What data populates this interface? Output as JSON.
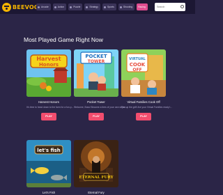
{
  "header": {
    "logo_text": "BEEVOO",
    "nav": [
      {
        "label": "Arcade",
        "icon": "gamepad-icon"
      },
      {
        "label": "Action",
        "icon": "bolt-icon"
      },
      {
        "label": "Puzzle",
        "icon": "puzzle-icon"
      },
      {
        "label": "Strategy",
        "icon": "chess-icon"
      },
      {
        "label": "Sports",
        "icon": "ball-icon"
      },
      {
        "label": "Shooting",
        "icon": "target-icon"
      },
      {
        "label": "Racing",
        "icon": "flag-icon"
      }
    ],
    "search_placeholder": "Search"
  },
  "main": {
    "title": "Most Played Game Right Now",
    "games": [
      {
        "name": "Harvest Honors",
        "desc": "It's time to head down to the farm for a fun-p...",
        "play": "PLAY"
      },
      {
        "name": "Pocket Tower",
        "desc": "Welcome, Boss! Become a tires of your own skysc...",
        "play": "PLAY"
      },
      {
        "name": "Virtual Families Cook Off",
        "desc": "Fire up the grill! Are your Virtual Families ready t...",
        "play": "PLAY"
      },
      {
        "name": "Let's Fish",
        "desc": "",
        "play": ""
      },
      {
        "name": "Eternal Fury",
        "desc": "",
        "play": ""
      }
    ]
  },
  "colors": {
    "background": "#2b2547",
    "header": "#1c1733",
    "logo": "#f5b400",
    "play_button": "#f24d6e",
    "active_tab": "#e04d90"
  }
}
